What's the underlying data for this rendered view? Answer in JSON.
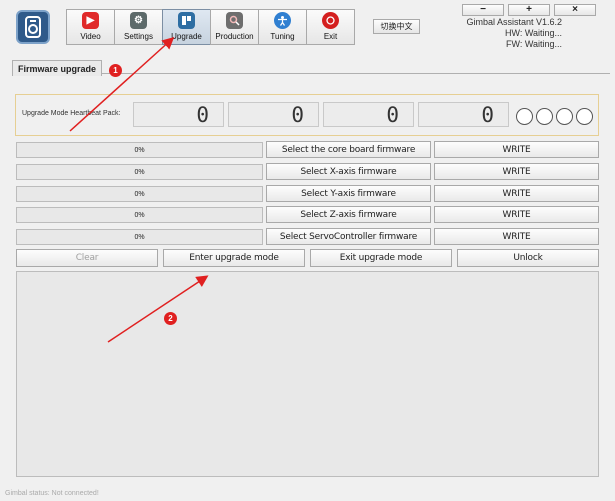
{
  "toolbar": {
    "items": [
      {
        "label": "Video",
        "icon": "video-icon",
        "color": "#e02a2a"
      },
      {
        "label": "Settings",
        "icon": "gear-icon",
        "color": "#5d6a6a"
      },
      {
        "label": "Upgrade",
        "icon": "upgrade-icon",
        "color": "#2e6ea3"
      },
      {
        "label": "Production",
        "icon": "search-icon",
        "color": "#6e6e6e"
      },
      {
        "label": "Tuning",
        "icon": "person-icon",
        "color": "#2f7fd1"
      },
      {
        "label": "Exit",
        "icon": "power-icon",
        "color": "#d41f1f"
      }
    ],
    "active": "Upgrade"
  },
  "language_button": "切换中文",
  "window_controls": {
    "minimize": "−",
    "maximize": "+",
    "close": "×"
  },
  "info": {
    "app_version": "Gimbal Assistant V1.6.2",
    "hw": "HW: Waiting...",
    "fw": "FW: Waiting..."
  },
  "tab": {
    "label": "Firmware upgrade"
  },
  "heartbeat": {
    "label": "Upgrade Mode Heartbeat Pack:",
    "digits": [
      "0",
      "0",
      "0",
      "0"
    ],
    "led_count": 4
  },
  "firmware_rows": [
    {
      "progress": "0%",
      "select_label": "Select the core board firmware",
      "write_label": "WRITE"
    },
    {
      "progress": "0%",
      "select_label": "Select X-axis firmware",
      "write_label": "WRITE"
    },
    {
      "progress": "0%",
      "select_label": "Select Y-axis firmware",
      "write_label": "WRITE"
    },
    {
      "progress": "0%",
      "select_label": "Select Z-axis firmware",
      "write_label": "WRITE"
    },
    {
      "progress": "0%",
      "select_label": "Select ServoController firmware",
      "write_label": "WRITE"
    }
  ],
  "actions": {
    "clear": "Clear",
    "enter_upgrade": "Enter upgrade mode",
    "exit_upgrade": "Exit upgrade mode",
    "unlock": "Unlock"
  },
  "status_bar": "Gimbal status: Not connected!",
  "annotations": {
    "badge1": "1",
    "badge2": "2",
    "color": "#e02020"
  }
}
